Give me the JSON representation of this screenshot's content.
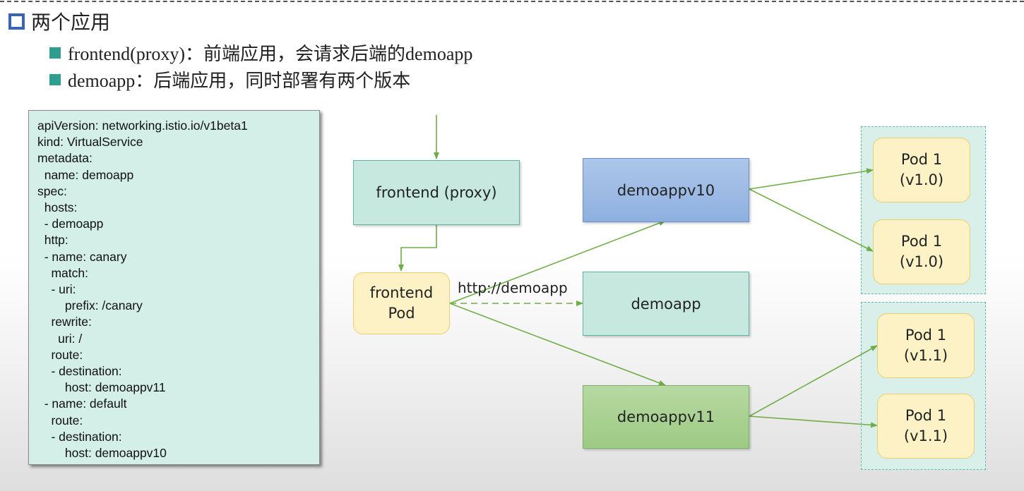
{
  "slide": {
    "heading": "两个应用",
    "bullets": [
      "frontend(proxy)：前端应用，会请求后端的demoapp",
      "demoapp：后端应用，同时部署有两个版本"
    ]
  },
  "yaml_lines": [
    "apiVersion: networking.istio.io/v1beta1",
    "kind: VirtualService",
    "metadata:",
    "  name: demoapp",
    "spec:",
    "  hosts:",
    "  - demoapp",
    "  http:",
    "  - name: canary",
    "    match:",
    "    - uri:",
    "        prefix: /canary",
    "    rewrite:",
    "      uri: /",
    "    route:",
    "    - destination:",
    "        host: demoappv11",
    "  - name: default",
    "    route:",
    "    - destination:",
    "        host: demoappv10"
  ],
  "diagram": {
    "frontend_proxy": "frontend (proxy)",
    "frontend_pod": "frontend\nPod",
    "edge_label": "http://demoapp",
    "demoapp": "demoapp",
    "demoappv10": "demoappv10",
    "demoappv11": "demoappv11",
    "pods_v10": [
      "Pod 1\n(v1.0)",
      "Pod 1\n(v1.0)"
    ],
    "pods_v11": [
      "Pod 1\n(v1.1)",
      "Pod 1\n(v1.1)"
    ]
  },
  "colors": {
    "arrow": "#70ad47",
    "heading_box": "#3a63b5",
    "bullet": "#2f9e8e"
  }
}
